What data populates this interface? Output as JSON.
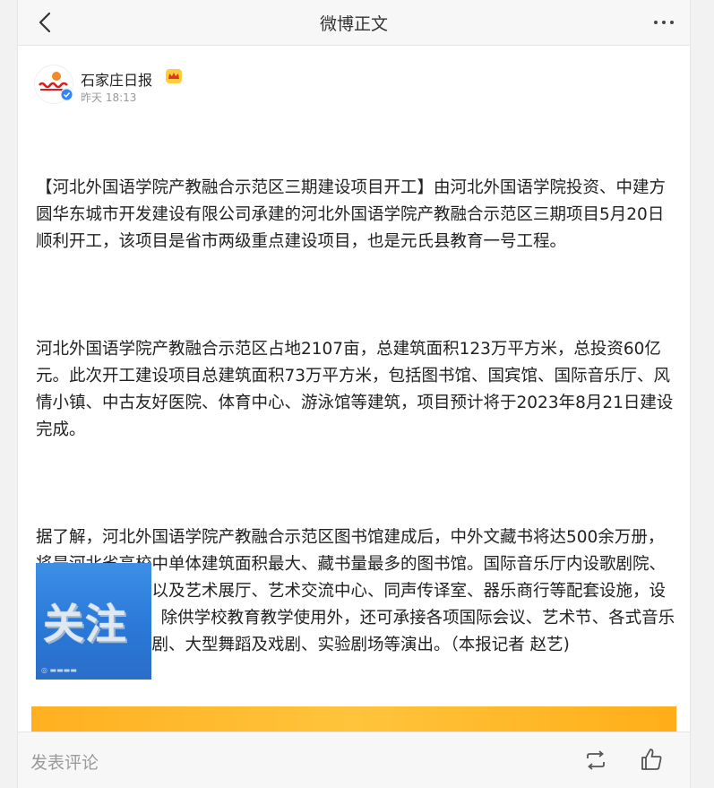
{
  "header": {
    "title": "微博正文",
    "back_icon": "chevron-left-icon",
    "more_icon": "more-dots-icon"
  },
  "author": {
    "name": "石家庄日报",
    "time": "昨天 18:13",
    "verified_color": "#2f86f6",
    "badge_icon": "crown-icon"
  },
  "post": {
    "paragraphs": [
      "【河北外国语学院产教融合示范区三期建设项目开工】由河北外国语学院投资、中建方圆华东城市开发建设有限公司承建的河北外国语学院产教融合示范区三期项目5月20日顺利开工，该项目是省市两级重点建设项目，也是元氏县教育一号工程。",
      "河北外国语学院产教融合示范区占地2107亩，总建筑面积123万平方米，总投资60亿元。此次开工建设项目总建筑面积73万平方米，包括图书馆、国宾馆、国际音乐厅、风情小镇、中古友好医院、体育中心、游泳馆等建筑，项目预计将于2023年8月21日建设完成。",
      "据了解，河北外国语学院产教融合示范区图书馆建成后，中外文藏书将达500余万册，将是河北省高校中单体建筑面积最大、藏书量最多的图书馆。国际音乐厅内设歌剧院、音乐厅、戏剧场以及艺术展厅、艺术交流中心、同声传译室、器乐商行等配套设施，设有3200个座位，除供学校教育教学使用外，还可承接各项国际会议、艺术节、各式音乐会、歌剧、音乐剧、大型舞蹈及戏剧、实验剧场等演出。（本报记者 赵艺)"
    ],
    "image_text": "关注"
  },
  "footer": {
    "comment_placeholder": "发表评论",
    "repost_icon": "repost-icon",
    "like_icon": "thumbs-up-icon"
  }
}
